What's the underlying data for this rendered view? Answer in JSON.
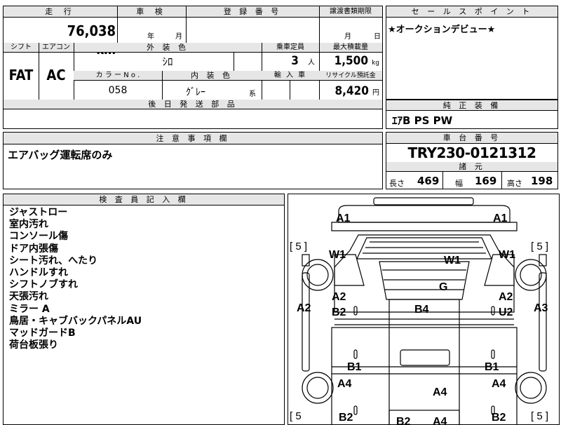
{
  "top": {
    "mileage_label": "走 行",
    "mileage_value": "76,038",
    "mileage_unit": "km",
    "inspection_label": "車 検",
    "inspection_year": "年",
    "inspection_month": "月",
    "registration_label": "登 録 番 号",
    "transfer_label": "譲渡書類期限",
    "transfer_month": "月",
    "transfer_day": "日",
    "shift_label": "シフト",
    "shift_value": "FAT",
    "aircon_label": "エアコン",
    "aircon_value": "AC",
    "exterior_label": "外 装 色",
    "exterior_value": "ｼﾛ",
    "capacity_label": "乗車定員",
    "capacity_value": "3",
    "capacity_unit": "人",
    "load_label": "最大積載量",
    "load_value": "1,500",
    "load_unit": "kg",
    "color_no_label": "カ ラ ー N o .",
    "color_no_value": "058",
    "interior_label": "内 装 色",
    "interior_value": "ｸﾞﾚｰ",
    "interior_suffix": "系",
    "import_label": "輸 入 車",
    "recycle_label": "リサイクル預託金",
    "recycle_value": "8,420",
    "recycle_unit": "円",
    "later_parts_label": "後 日 発 送 部 品"
  },
  "sales": {
    "label": "セ ー ル ス ポ イ ン ト",
    "text": "★オークションデビュー★"
  },
  "equipment": {
    "label": "純 正 装 備",
    "value": "ｴｱB PS PW"
  },
  "caution": {
    "label": "注 意 事 項 欄",
    "text": "エアバッグ運転席のみ"
  },
  "chassis": {
    "label": "車 台 番 号",
    "value": "TRY230-0121312",
    "dims_label": "諸 元",
    "length_label": "長さ",
    "length_value": "469",
    "width_label": "幅",
    "width_value": "169",
    "height_label": "高さ",
    "height_value": "198"
  },
  "inspector": {
    "label": "検 査 員 記 入 欄",
    "notes": [
      "ジャストロー",
      "室内汚れ",
      "コンソール傷",
      "ドア内張傷",
      "シート汚れ、へたり",
      "ハンドルすれ",
      "シフトノブすれ",
      "天張汚れ",
      "ミラー A",
      "鳥居・キャブバックパネルAU",
      "マッドガードB",
      "荷台板張り"
    ]
  },
  "diagram": {
    "tire_left_top": "[ 5 ]",
    "tire_right_top": "[ 5 ]",
    "tire_left_bottom": "[ 5",
    "tire_right_bottom": "[ 5 ]",
    "labels": {
      "a1_left": "A1",
      "a1_right": "A1",
      "w1_left": "W1",
      "w1_center": "W1",
      "w1_right": "W1",
      "g": "G",
      "a2_left_outer": "A2",
      "a2_left_inner": "A2",
      "b2_left": "B2",
      "b4": "B4",
      "a2_right_inner": "A2",
      "u2_right": "U2",
      "a3_right": "A3",
      "b1_left": "B1",
      "b1_right": "B1",
      "a4_left": "A4",
      "a4_center": "A4",
      "a4_right": "A4",
      "b2_bottom_left": "B2",
      "b2_bottom_center": "B2",
      "a4_bottom_center": "A4",
      "b2_bottom_right": "B2"
    }
  }
}
